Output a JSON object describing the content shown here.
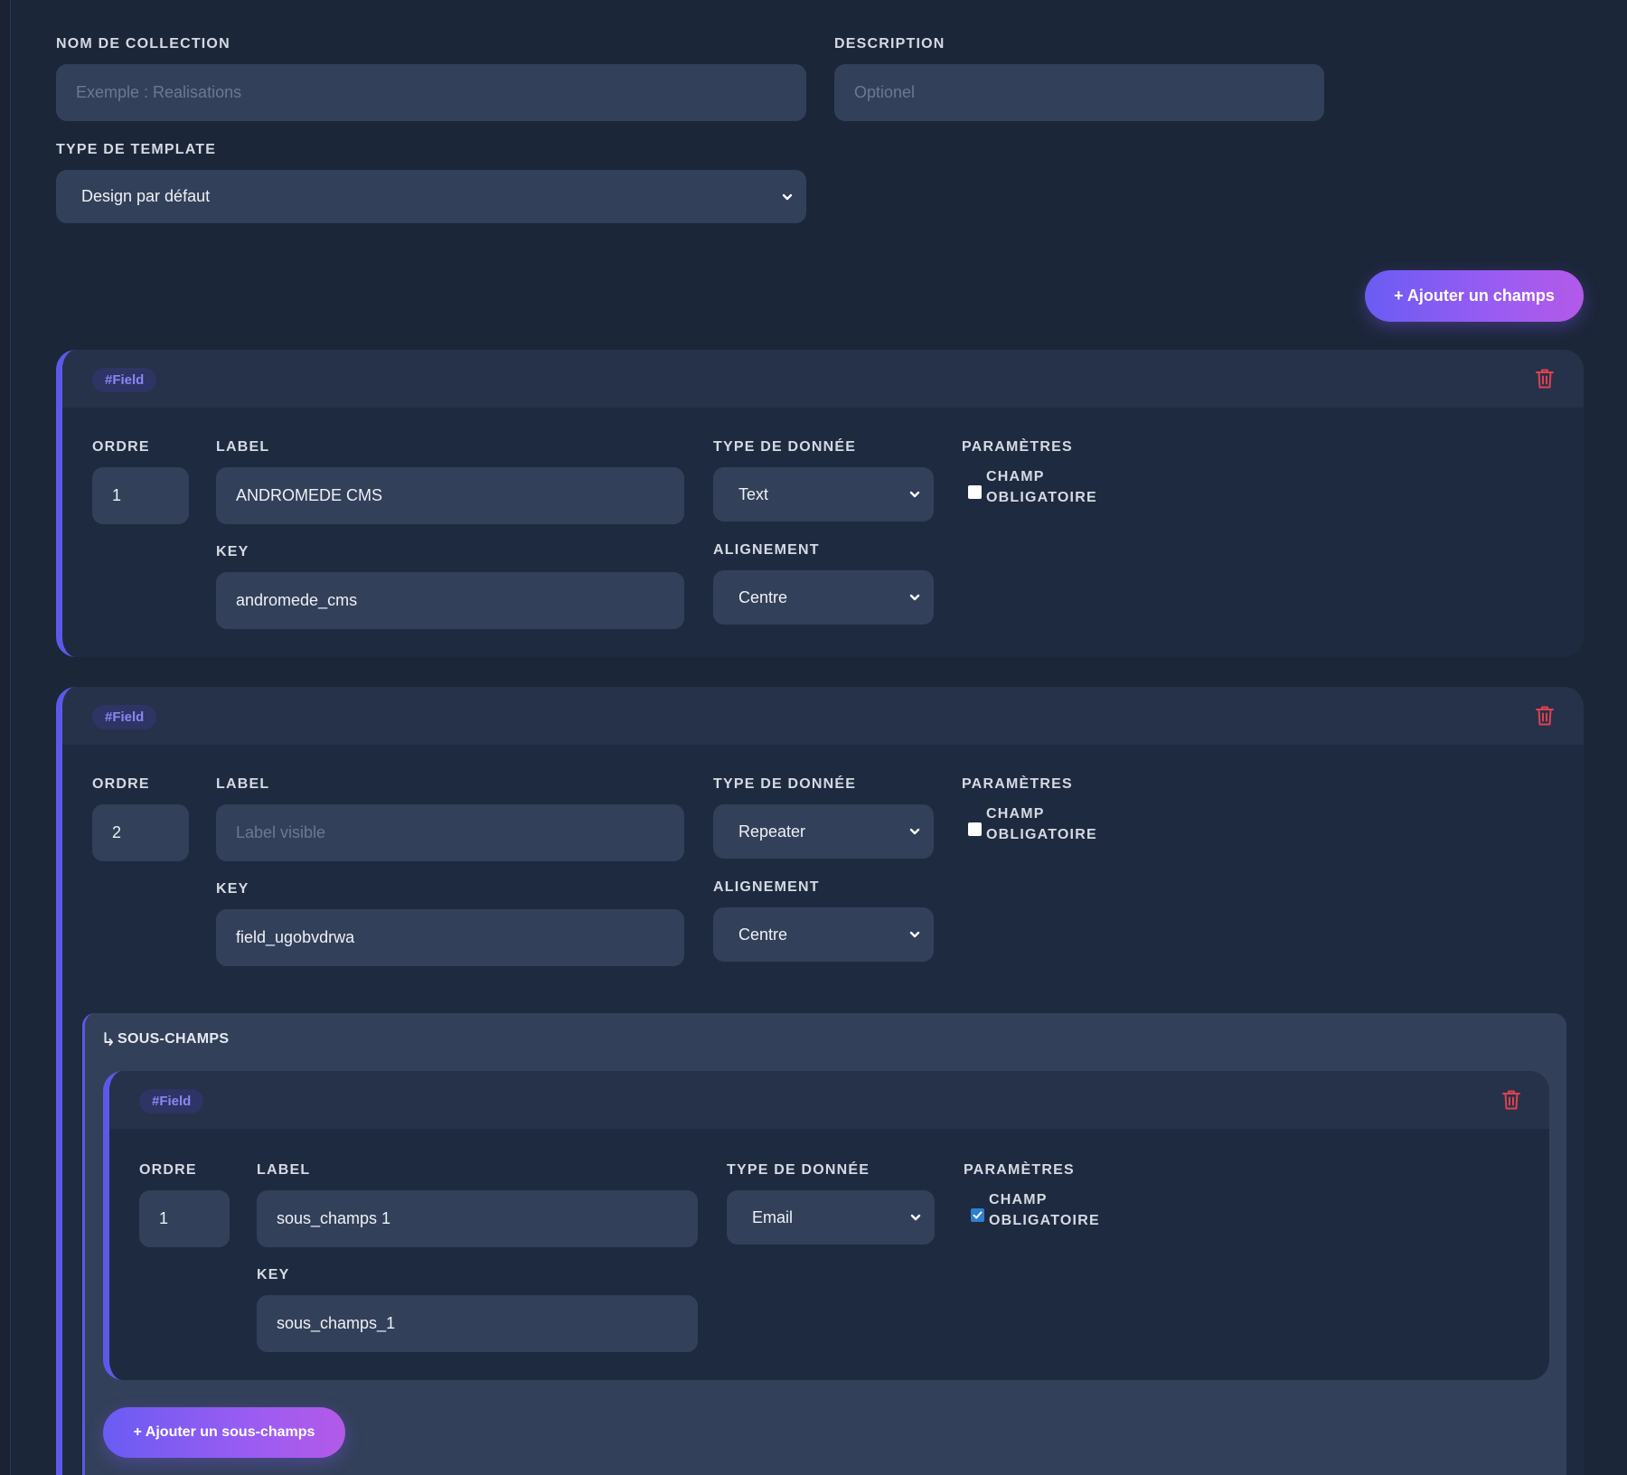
{
  "collection": {
    "name_label": "NOM DE COLLECTION",
    "name_placeholder": "Exemple : Realisations",
    "description_label": "DESCRIPTION",
    "description_placeholder": "Optionel",
    "template_label": "TYPE DE TEMPLATE",
    "template_value": "Design par défaut"
  },
  "add_field_button": "+ Ajouter un champs",
  "fields": [
    {
      "tag": "#Field",
      "order_label": "ORDRE",
      "order_value": "1",
      "label_label": "LABEL",
      "label_value": "ANDROMEDE CMS",
      "type_label": "TYPE DE DONNÉE",
      "type_value": "Text",
      "params_label": "PARAMÈTRES",
      "required_line1": "CHAMP",
      "required_line2": "OBLIGATOIRE",
      "required_checked": false,
      "key_label": "KEY",
      "key_value": "andromede_cms",
      "align_label": "ALIGNEMENT",
      "align_value": "Centre"
    },
    {
      "tag": "#Field",
      "order_label": "ORDRE",
      "order_value": "2",
      "label_label": "LABEL",
      "label_placeholder": "Label visible",
      "type_label": "TYPE DE DONNÉE",
      "type_value": "Repeater",
      "params_label": "PARAMÈTRES",
      "required_line1": "CHAMP",
      "required_line2": "OBLIGATOIRE",
      "required_checked": false,
      "key_label": "KEY",
      "key_value": "field_ugobvdrwa",
      "align_label": "ALIGNEMENT",
      "align_value": "Centre",
      "subfields_title": "SOUS-CHAMPS",
      "subfields": [
        {
          "tag": "#Field",
          "order_label": "ORDRE",
          "order_value": "1",
          "label_label": "LABEL",
          "label_value": "sous_champs 1",
          "type_label": "TYPE DE DONNÉE",
          "type_value": "Email",
          "params_label": "PARAMÈTRES",
          "required_line1": "CHAMP",
          "required_line2": "OBLIGATOIRE",
          "required_checked": true,
          "key_label": "KEY",
          "key_value": "sous_champs_1"
        }
      ],
      "add_subfield_button": "+ Ajouter un sous-champs"
    }
  ],
  "icons": {
    "trash": "trash-icon",
    "chevron": "chevron-down-icon",
    "subfield_arrow": "corner-down-right-icon"
  },
  "colors": {
    "background": "#1c2639",
    "accent": "#5d59e8",
    "danger": "#e0414f",
    "input_bg": "#33405a"
  }
}
